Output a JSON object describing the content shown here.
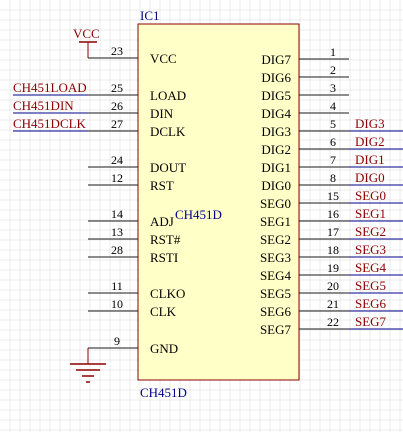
{
  "component": {
    "designator": "IC1",
    "comment_center": "CH451D",
    "comment_bottom": "CH451D"
  },
  "colors": {
    "background": "#ffffff",
    "grid": "#d8d8d8",
    "body_fill": "#ffffc8",
    "body_stroke": "#8b0000",
    "pin_line": "#1a1a1a",
    "pin_name": "#000000",
    "pin_number": "#000000",
    "designator": "#00008b",
    "net_wire": "#00008b",
    "net_label": "#8b0000",
    "power_symbol": "#8b0000",
    "ground_symbol": "#8b0000"
  },
  "left_pins": [
    {
      "number": "23",
      "name": "VCC",
      "net": "VCC",
      "net_kind": "power"
    },
    {
      "number": "25",
      "name": "LOAD",
      "net": "CH451LOAD",
      "net_kind": "wire"
    },
    {
      "number": "26",
      "name": "DIN",
      "net": "CH451DIN",
      "net_kind": "wire"
    },
    {
      "number": "27",
      "name": "DCLK",
      "net": "CH451DCLK",
      "net_kind": "wire"
    },
    {
      "number": "24",
      "name": "DOUT",
      "net": "",
      "net_kind": "none"
    },
    {
      "number": "12",
      "name": "RST",
      "net": "",
      "net_kind": "none"
    },
    {
      "number": "14",
      "name": "ADJ",
      "net": "",
      "net_kind": "none"
    },
    {
      "number": "13",
      "name": "RST#",
      "net": "",
      "net_kind": "none"
    },
    {
      "number": "28",
      "name": "RSTI",
      "net": "",
      "net_kind": "none"
    },
    {
      "number": "11",
      "name": "CLKO",
      "net": "",
      "net_kind": "none"
    },
    {
      "number": "10",
      "name": "CLK",
      "net": "",
      "net_kind": "none"
    },
    {
      "number": "9",
      "name": "GND",
      "net": "",
      "net_kind": "ground"
    }
  ],
  "right_pins": [
    {
      "number": "1",
      "name": "DIG7",
      "net": ""
    },
    {
      "number": "2",
      "name": "DIG6",
      "net": ""
    },
    {
      "number": "3",
      "name": "DIG5",
      "net": ""
    },
    {
      "number": "4",
      "name": "DIG4",
      "net": ""
    },
    {
      "number": "5",
      "name": "DIG3",
      "net": "DIG3"
    },
    {
      "number": "6",
      "name": "DIG2",
      "net": "DIG2"
    },
    {
      "number": "7",
      "name": "DIG1",
      "net": "DIG1"
    },
    {
      "number": "8",
      "name": "DIG0",
      "net": "DIG0"
    },
    {
      "number": "15",
      "name": "SEG0",
      "net": "SEG0"
    },
    {
      "number": "16",
      "name": "SEG1",
      "net": "SEG1"
    },
    {
      "number": "17",
      "name": "SEG2",
      "net": "SEG2"
    },
    {
      "number": "18",
      "name": "SEG3",
      "net": "SEG3"
    },
    {
      "number": "19",
      "name": "SEG4",
      "net": "SEG4"
    },
    {
      "number": "20",
      "name": "SEG5",
      "net": "SEG5"
    },
    {
      "number": "21",
      "name": "SEG6",
      "net": "SEG6"
    },
    {
      "number": "22",
      "name": "SEG7",
      "net": "SEG7"
    }
  ]
}
